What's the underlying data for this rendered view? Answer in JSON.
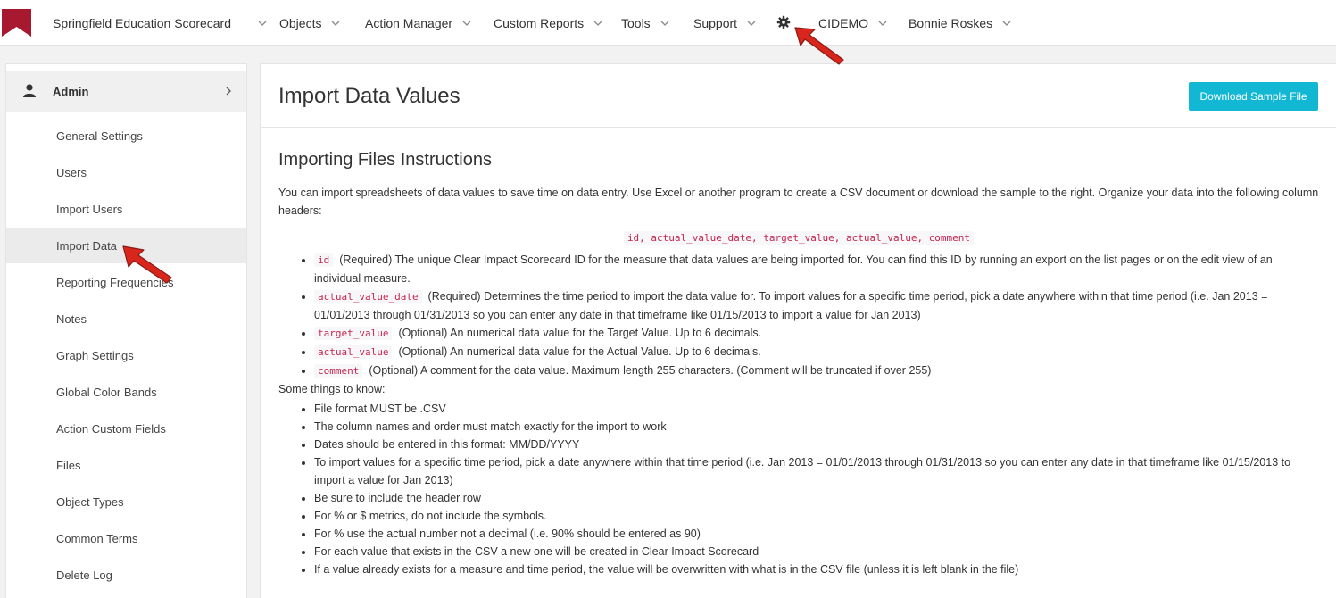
{
  "nav": {
    "app_title": "Springfield Education Scorecard",
    "items": [
      {
        "label": "Objects"
      },
      {
        "label": "Action Manager"
      },
      {
        "label": "Custom Reports"
      },
      {
        "label": "Tools"
      },
      {
        "label": "Support"
      }
    ],
    "settings_icon": "gear-icon",
    "org": "CIDEMO",
    "user": "Bonnie Roskes",
    "brand_color": "#a6192e"
  },
  "sidebar": {
    "header": {
      "label": "Admin",
      "icon": "user-icon"
    },
    "items": [
      {
        "label": "General Settings"
      },
      {
        "label": "Users"
      },
      {
        "label": "Import Users"
      },
      {
        "label": "Import Data"
      },
      {
        "label": "Reporting Frequencies"
      },
      {
        "label": "Notes"
      },
      {
        "label": "Graph Settings"
      },
      {
        "label": "Global Color Bands"
      },
      {
        "label": "Action Custom Fields"
      },
      {
        "label": "Files"
      },
      {
        "label": "Object Types"
      },
      {
        "label": "Common Terms"
      },
      {
        "label": "Delete Log"
      }
    ],
    "active": "Import Data"
  },
  "main": {
    "title": "Import Data Values",
    "download_button": "Download Sample File",
    "button_color": "#12b7d4",
    "section_title": "Importing Files Instructions",
    "intro": "You can import spreadsheets of data values to save time on data entry. Use Excel or another program to create a CSV document or download the sample to the right. Organize your data into the following column headers:",
    "headers_code": "id, actual_value_date, target_value, actual_value, comment",
    "columns": [
      {
        "code": "id",
        "text": "(Required) The unique Clear Impact Scorecard ID for the measure that data values are being imported for. You can find this ID by running an export on the list pages or on the edit view of an individual measure."
      },
      {
        "code": "actual_value_date",
        "text": "(Required) Determines the time period to import the data value for. To import values for a specific time period, pick a date anywhere within that time period (i.e. Jan 2013 = 01/01/2013 through 01/31/2013 so you can enter any date in that timeframe like 01/15/2013 to import a value for Jan 2013)"
      },
      {
        "code": "target_value",
        "text": "(Optional) An numerical data value for the Target Value. Up to 6 decimals."
      },
      {
        "code": "actual_value",
        "text": "(Optional) An numerical data value for the Actual Value. Up to 6 decimals."
      },
      {
        "code": "comment",
        "text": "(Optional) A comment for the data value. Maximum length 255 characters. (Comment will be truncated if over 255)"
      }
    ],
    "things_title": "Some things to know:",
    "things": [
      "File format MUST be .CSV",
      "The column names and order must match exactly for the import to work",
      "Dates should be entered in this format: MM/DD/YYYY",
      "To import values for a specific time period, pick a date anywhere within that time period (i.e. Jan 2013 = 01/01/2013 through 01/31/2013 so you can enter any date in that timeframe like 01/15/2013 to import a value for Jan 2013)",
      "Be sure to include the header row",
      "For % or $ metrics, do not include the symbols.",
      "For % use the actual number not a decimal (i.e. 90% should be entered as 90)",
      "For each value that exists in the CSV a new one will be created in Clear Impact Scorecard",
      "If a value already exists for a measure and time period, the value will be overwritten with what is in the CSV file (unless it is left blank in the file)"
    ]
  },
  "annotations": {
    "arrow_color": "#d9261c"
  }
}
